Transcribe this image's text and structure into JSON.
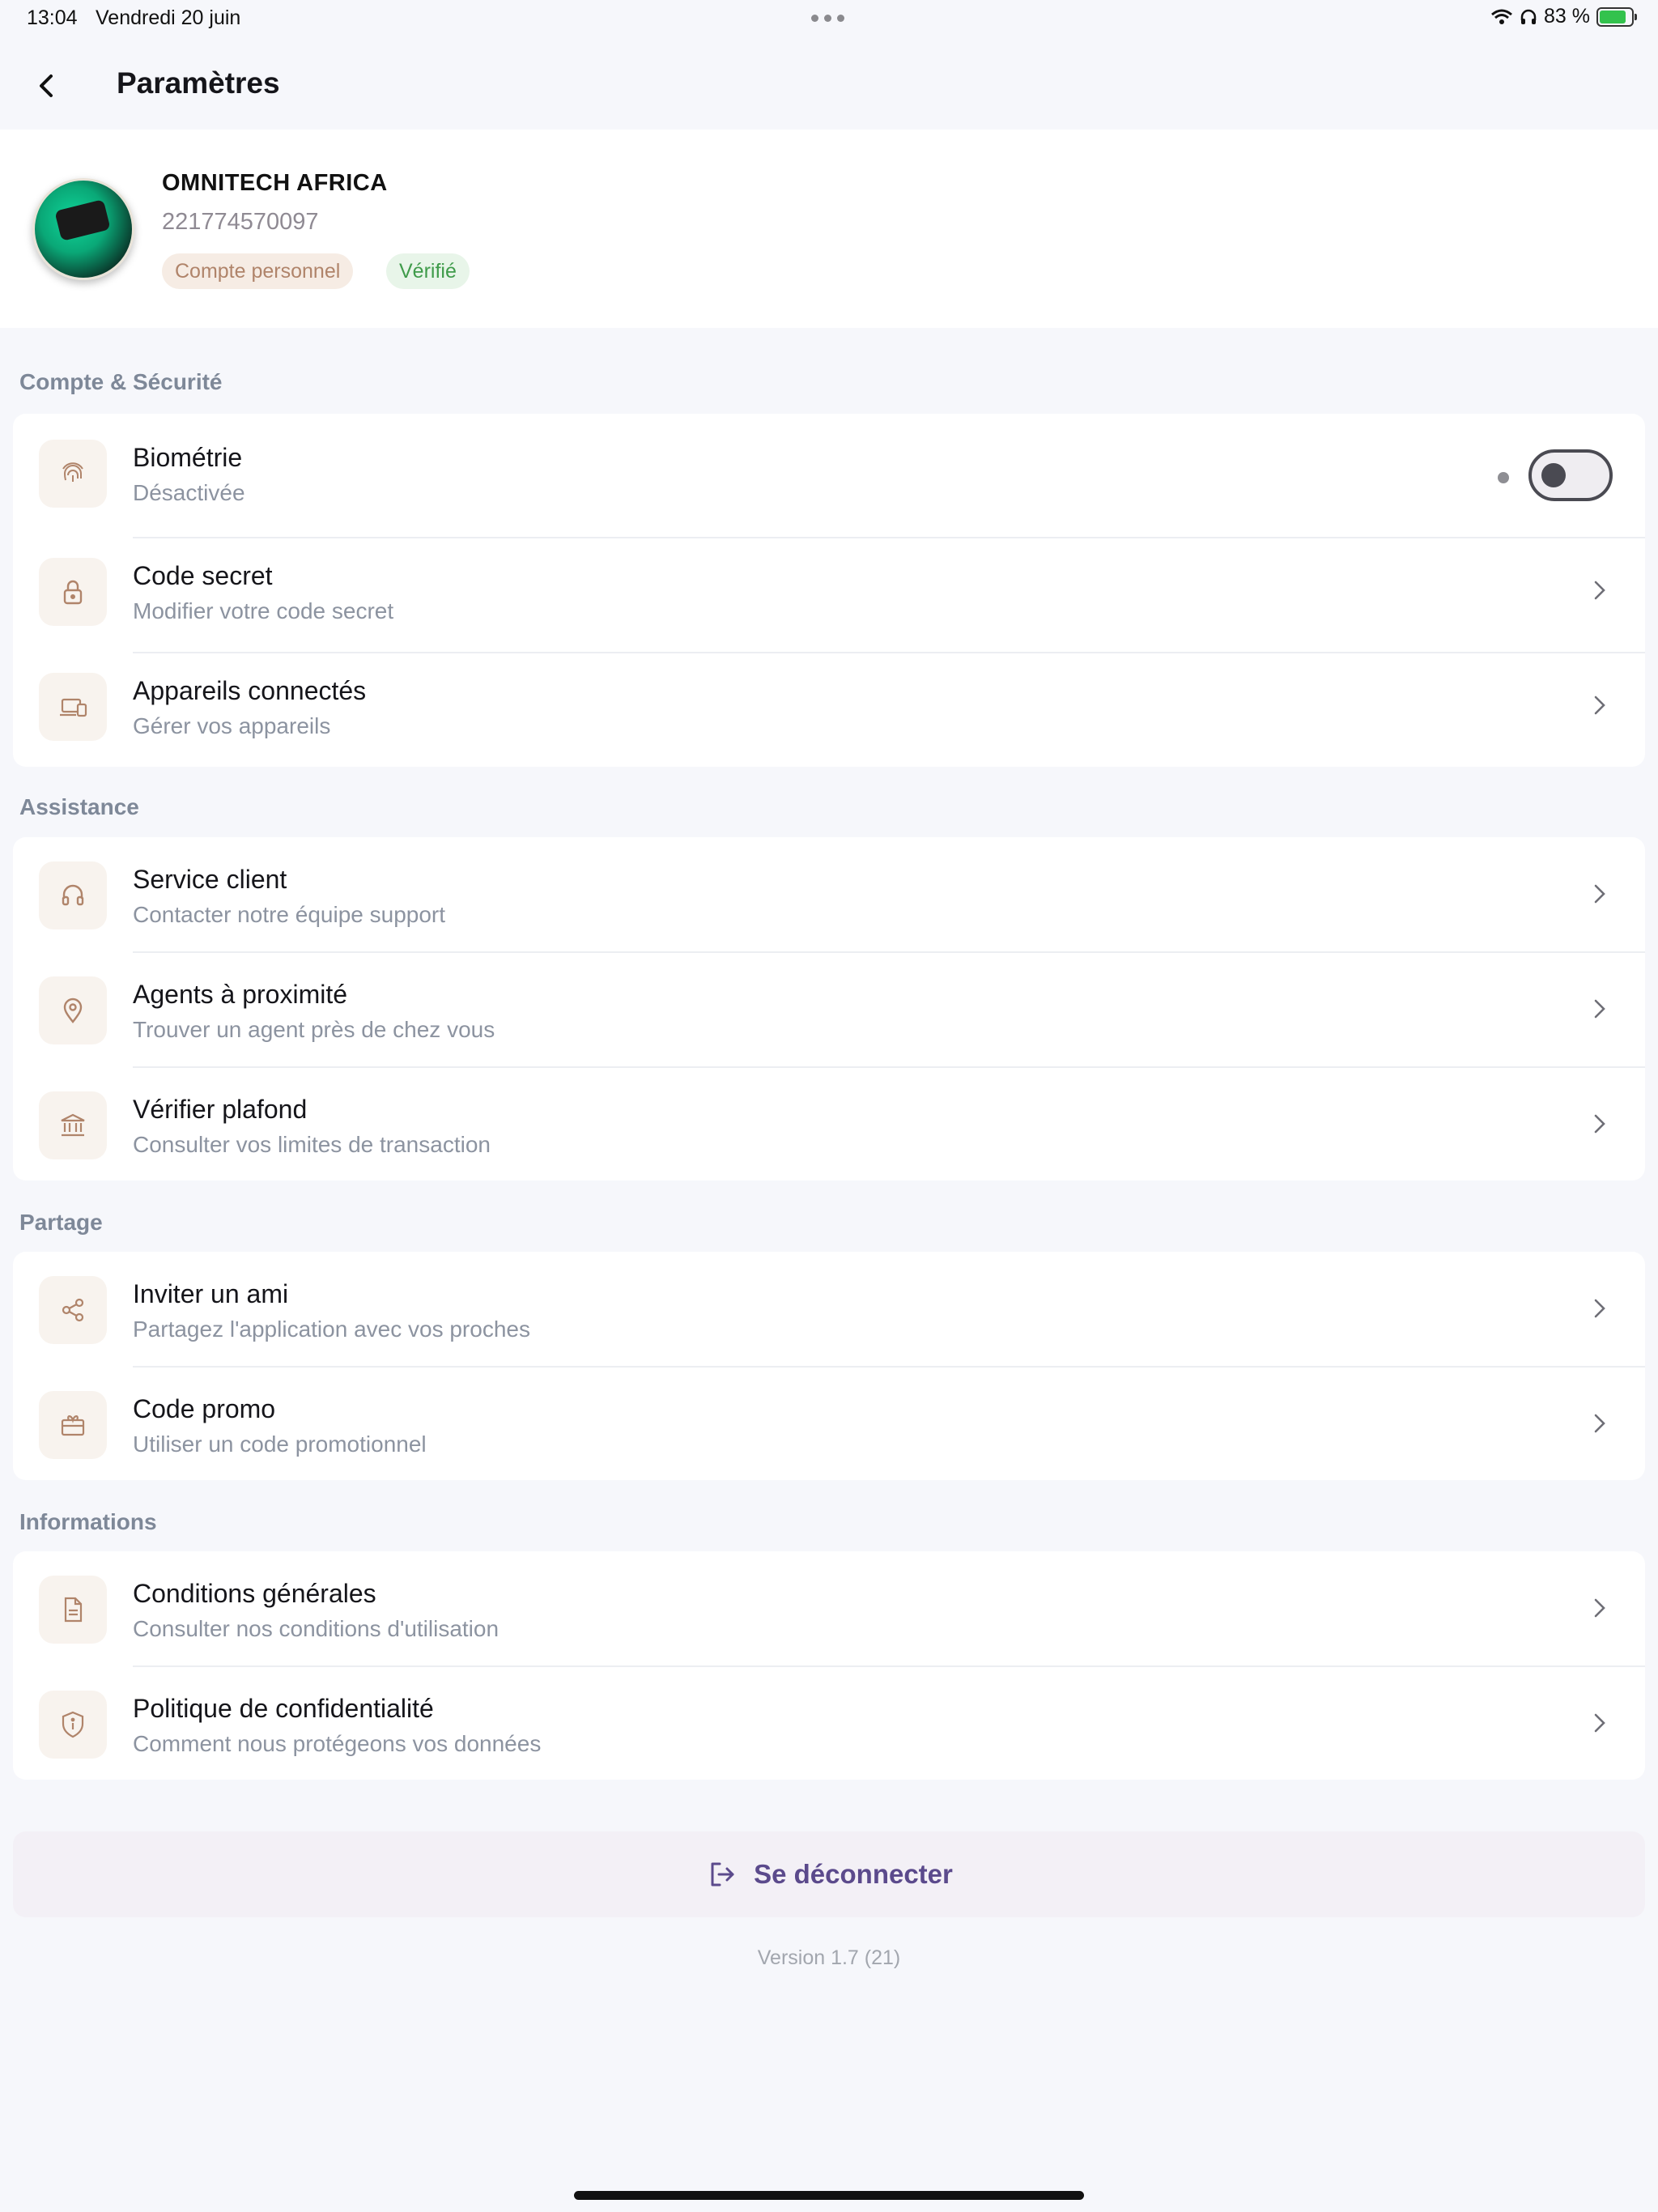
{
  "status_bar": {
    "time": "13:04",
    "date": "Vendredi 20 juin",
    "battery": "83 %",
    "battery_level": 0.83,
    "icons": [
      "wifi-icon",
      "headphones-icon",
      "battery-charging-icon"
    ]
  },
  "header": {
    "title": "Paramètres",
    "back_icon": "chevron-left-icon"
  },
  "profile": {
    "name": "OMNITECH AFRICA",
    "phone": "221774570097",
    "badge_account": "Compte personnel",
    "badge_verified": "Vérifié"
  },
  "sections": {
    "security": {
      "title": "Compte & Sécurité",
      "biometrics": {
        "label": "Biométrie",
        "sub": "Désactivée",
        "icon": "fingerprint-icon",
        "enabled": false
      },
      "secret_code": {
        "label": "Code secret",
        "sub": "Modifier votre code secret",
        "icon": "lock-icon"
      },
      "devices": {
        "label": "Appareils connectés",
        "sub": "Gérer vos appareils",
        "icon": "devices-icon"
      }
    },
    "assistance": {
      "title": "Assistance",
      "support": {
        "label": "Service client",
        "sub": "Contacter notre équipe support",
        "icon": "headset-icon"
      },
      "agents": {
        "label": "Agents à proximité",
        "sub": "Trouver un agent près de chez vous",
        "icon": "map-pin-icon"
      },
      "limit": {
        "label": "Vérifier plafond",
        "sub": "Consulter vos limites de transaction",
        "icon": "bank-icon"
      }
    },
    "sharing": {
      "title": "Partage",
      "invite": {
        "label": "Inviter un ami",
        "sub": "Partagez l'application avec vos proches",
        "icon": "share-icon"
      },
      "promo": {
        "label": "Code promo",
        "sub": "Utiliser un code promotionnel",
        "icon": "gift-icon"
      }
    },
    "info": {
      "title": "Informations",
      "terms": {
        "label": "Conditions générales",
        "sub": "Consulter nos conditions d'utilisation",
        "icon": "document-icon"
      },
      "privacy": {
        "label": "Politique de confidentialité",
        "sub": "Comment nous protégeons vos données",
        "icon": "shield-info-icon"
      }
    }
  },
  "logout": {
    "label": "Se déconnecter",
    "icon": "logout-icon"
  },
  "version": "Version 1.7 (21)",
  "colors": {
    "accent": "#5b4a8c",
    "icon": "#b0846a",
    "verified": "#3f9b4a",
    "background": "#f6f7fb"
  }
}
